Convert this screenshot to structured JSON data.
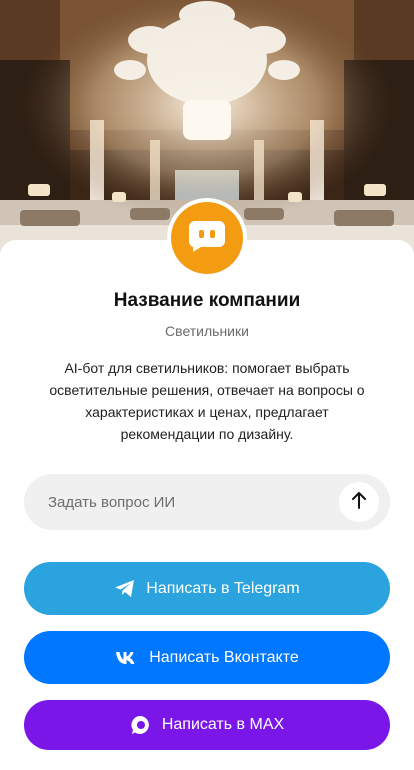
{
  "company": {
    "name": "Название компании",
    "category": "Светильники",
    "description": "AI-бот для светильников: помогает выбрать осветительные решения, отвечает на вопросы о характеристиках и ценах, предлагает рекомендации по дизайну."
  },
  "ask": {
    "placeholder": "Задать вопрос ИИ",
    "send_icon": "arrow-up-icon"
  },
  "buttons": {
    "telegram": {
      "label": "Написать в Telegram",
      "icon": "telegram-icon",
      "color": "#2aa3df"
    },
    "vk": {
      "label": "Написать Вконтакте",
      "icon": "vk-icon",
      "color": "#0077ff"
    },
    "max": {
      "label": "Написать в MAX",
      "icon": "max-icon",
      "color": "#7b16e8"
    }
  },
  "colors": {
    "avatar": "#f39c12"
  }
}
